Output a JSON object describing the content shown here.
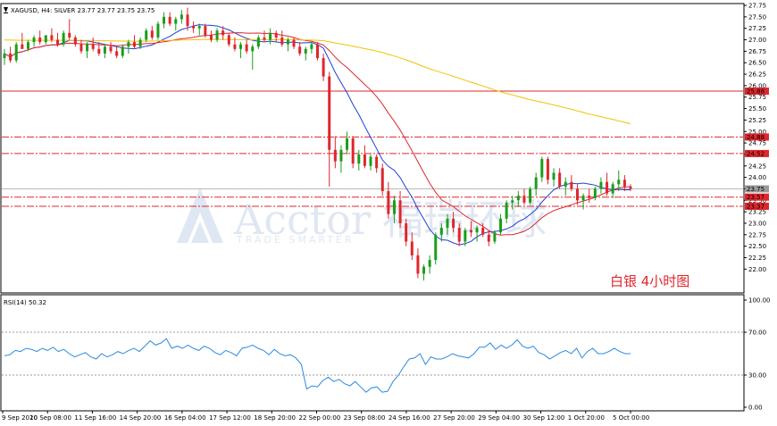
{
  "chart_data": {
    "type": "candlestick",
    "symbol_header": "XAGUSD, H4:  SILVER  23.77 23.77 23.75 23.75",
    "annotation": "白银  4小时图",
    "watermark": {
      "brand": "Acctor",
      "brand_cn": "福瑞环球",
      "tagline": "TRADE SMARTER"
    },
    "main_panel": {
      "y_axis": {
        "min": 21.5,
        "max": 27.75,
        "ticks": [
          "27.75",
          "27.50",
          "27.25",
          "27.00",
          "26.75",
          "26.50",
          "26.25",
          "26.00",
          "25.75",
          "25.50",
          "25.25",
          "25.00",
          "24.75",
          "24.50",
          "24.25",
          "24.00",
          "23.75",
          "23.50",
          "23.25",
          "23.00",
          "22.75",
          "22.50",
          "22.25",
          "22.00"
        ]
      },
      "levels": [
        {
          "label": "25.88",
          "value": 25.88,
          "style": "solid"
        },
        {
          "label": "24.88",
          "value": 24.88,
          "style": "dashdot"
        },
        {
          "label": "24.52",
          "value": 24.52,
          "style": "dashdot"
        },
        {
          "label": "23.57",
          "value": 23.57,
          "style": "dashdot"
        },
        {
          "label": "23.37",
          "value": 23.37,
          "style": "dashdot"
        }
      ],
      "current_price": {
        "label": "23.75",
        "value": 23.75
      },
      "candles": [
        {
          "o": 26.6,
          "h": 26.8,
          "l": 26.45,
          "c": 26.7
        },
        {
          "o": 26.7,
          "h": 26.85,
          "l": 26.5,
          "c": 26.55
        },
        {
          "o": 26.55,
          "h": 26.95,
          "l": 26.5,
          "c": 26.9
        },
        {
          "o": 26.9,
          "h": 27.15,
          "l": 26.8,
          "c": 26.8
        },
        {
          "o": 26.8,
          "h": 27.0,
          "l": 26.75,
          "c": 26.95
        },
        {
          "o": 26.95,
          "h": 27.1,
          "l": 26.85,
          "c": 27.05
        },
        {
          "o": 27.05,
          "h": 27.2,
          "l": 26.9,
          "c": 26.95
        },
        {
          "o": 26.95,
          "h": 27.1,
          "l": 26.9,
          "c": 27.1
        },
        {
          "o": 27.1,
          "h": 27.25,
          "l": 26.95,
          "c": 27.0
        },
        {
          "o": 27.0,
          "h": 27.15,
          "l": 26.85,
          "c": 26.9
        },
        {
          "o": 26.9,
          "h": 27.2,
          "l": 26.85,
          "c": 27.15
        },
        {
          "o": 27.15,
          "h": 27.45,
          "l": 27.0,
          "c": 27.05
        },
        {
          "o": 27.05,
          "h": 27.1,
          "l": 26.85,
          "c": 26.9
        },
        {
          "o": 26.9,
          "h": 27.0,
          "l": 26.7,
          "c": 26.75
        },
        {
          "o": 26.75,
          "h": 26.95,
          "l": 26.6,
          "c": 26.9
        },
        {
          "o": 26.9,
          "h": 27.05,
          "l": 26.75,
          "c": 26.8
        },
        {
          "o": 26.8,
          "h": 26.95,
          "l": 26.65,
          "c": 26.7
        },
        {
          "o": 26.7,
          "h": 26.9,
          "l": 26.6,
          "c": 26.85
        },
        {
          "o": 26.85,
          "h": 26.95,
          "l": 26.7,
          "c": 26.75
        },
        {
          "o": 26.75,
          "h": 26.85,
          "l": 26.6,
          "c": 26.65
        },
        {
          "o": 26.65,
          "h": 26.9,
          "l": 26.6,
          "c": 26.85
        },
        {
          "o": 26.85,
          "h": 27.0,
          "l": 26.7,
          "c": 26.95
        },
        {
          "o": 26.95,
          "h": 27.1,
          "l": 26.8,
          "c": 26.85
        },
        {
          "o": 26.85,
          "h": 27.05,
          "l": 26.8,
          "c": 27.0
        },
        {
          "o": 27.0,
          "h": 27.25,
          "l": 26.95,
          "c": 27.2
        },
        {
          "o": 27.2,
          "h": 27.3,
          "l": 27.0,
          "c": 27.05
        },
        {
          "o": 27.05,
          "h": 27.4,
          "l": 27.0,
          "c": 27.35
        },
        {
          "o": 27.35,
          "h": 27.6,
          "l": 27.25,
          "c": 27.5
        },
        {
          "o": 27.5,
          "h": 27.6,
          "l": 27.3,
          "c": 27.35
        },
        {
          "o": 27.35,
          "h": 27.5,
          "l": 27.2,
          "c": 27.45
        },
        {
          "o": 27.45,
          "h": 27.65,
          "l": 27.35,
          "c": 27.55
        },
        {
          "o": 27.55,
          "h": 27.7,
          "l": 27.2,
          "c": 27.3
        },
        {
          "o": 27.3,
          "h": 27.4,
          "l": 27.15,
          "c": 27.25
        },
        {
          "o": 27.25,
          "h": 27.35,
          "l": 27.1,
          "c": 27.3
        },
        {
          "o": 27.3,
          "h": 27.35,
          "l": 27.05,
          "c": 27.1
        },
        {
          "o": 27.1,
          "h": 27.2,
          "l": 26.95,
          "c": 27.0
        },
        {
          "o": 27.0,
          "h": 27.25,
          "l": 26.95,
          "c": 27.2
        },
        {
          "o": 27.2,
          "h": 27.3,
          "l": 27.0,
          "c": 27.1
        },
        {
          "o": 27.1,
          "h": 27.15,
          "l": 26.85,
          "c": 26.9
        },
        {
          "o": 26.9,
          "h": 27.05,
          "l": 26.75,
          "c": 26.8
        },
        {
          "o": 26.8,
          "h": 26.95,
          "l": 26.6,
          "c": 26.9
        },
        {
          "o": 26.9,
          "h": 27.0,
          "l": 26.7,
          "c": 26.75
        },
        {
          "o": 26.75,
          "h": 26.9,
          "l": 26.35,
          "c": 26.85
        },
        {
          "o": 26.85,
          "h": 27.1,
          "l": 26.8,
          "c": 27.05
        },
        {
          "o": 27.05,
          "h": 27.2,
          "l": 26.95,
          "c": 27.0
        },
        {
          "o": 27.0,
          "h": 27.25,
          "l": 26.9,
          "c": 27.15
        },
        {
          "o": 27.15,
          "h": 27.2,
          "l": 26.95,
          "c": 27.05
        },
        {
          "o": 27.05,
          "h": 27.2,
          "l": 26.85,
          "c": 26.9
        },
        {
          "o": 26.9,
          "h": 27.05,
          "l": 26.75,
          "c": 27.0
        },
        {
          "o": 27.0,
          "h": 27.05,
          "l": 26.8,
          "c": 26.85
        },
        {
          "o": 26.85,
          "h": 26.95,
          "l": 26.65,
          "c": 26.7
        },
        {
          "o": 26.7,
          "h": 26.85,
          "l": 26.55,
          "c": 26.8
        },
        {
          "o": 26.8,
          "h": 26.95,
          "l": 26.7,
          "c": 26.9
        },
        {
          "o": 26.9,
          "h": 26.95,
          "l": 26.55,
          "c": 26.6
        },
        {
          "o": 26.6,
          "h": 26.7,
          "l": 26.1,
          "c": 26.2
        },
        {
          "o": 26.2,
          "h": 26.3,
          "l": 23.8,
          "c": 24.6
        },
        {
          "o": 24.6,
          "h": 24.9,
          "l": 24.2,
          "c": 24.35
        },
        {
          "o": 24.35,
          "h": 24.7,
          "l": 24.1,
          "c": 24.6
        },
        {
          "o": 24.6,
          "h": 25.0,
          "l": 24.5,
          "c": 24.85
        },
        {
          "o": 24.85,
          "h": 24.9,
          "l": 24.2,
          "c": 24.3
        },
        {
          "o": 24.3,
          "h": 24.6,
          "l": 24.15,
          "c": 24.5
        },
        {
          "o": 24.5,
          "h": 24.7,
          "l": 24.2,
          "c": 24.25
        },
        {
          "o": 24.25,
          "h": 24.5,
          "l": 24.15,
          "c": 24.45
        },
        {
          "o": 24.45,
          "h": 24.5,
          "l": 24.1,
          "c": 24.2
        },
        {
          "o": 24.2,
          "h": 24.3,
          "l": 23.6,
          "c": 23.7
        },
        {
          "o": 23.7,
          "h": 23.9,
          "l": 23.1,
          "c": 23.2
        },
        {
          "o": 23.2,
          "h": 23.6,
          "l": 23.0,
          "c": 23.5
        },
        {
          "o": 23.5,
          "h": 23.7,
          "l": 22.9,
          "c": 23.0
        },
        {
          "o": 23.0,
          "h": 23.1,
          "l": 22.5,
          "c": 22.6
        },
        {
          "o": 22.6,
          "h": 22.8,
          "l": 22.2,
          "c": 22.3
        },
        {
          "o": 22.3,
          "h": 22.45,
          "l": 21.8,
          "c": 21.9
        },
        {
          "o": 21.9,
          "h": 22.1,
          "l": 21.75,
          "c": 22.05
        },
        {
          "o": 22.05,
          "h": 22.3,
          "l": 21.9,
          "c": 22.2
        },
        {
          "o": 22.2,
          "h": 22.8,
          "l": 22.1,
          "c": 22.75
        },
        {
          "o": 22.75,
          "h": 23.0,
          "l": 22.6,
          "c": 22.9
        },
        {
          "o": 22.9,
          "h": 23.2,
          "l": 22.75,
          "c": 23.1
        },
        {
          "o": 23.1,
          "h": 23.25,
          "l": 22.8,
          "c": 22.9
        },
        {
          "o": 22.9,
          "h": 23.0,
          "l": 22.5,
          "c": 22.6
        },
        {
          "o": 22.6,
          "h": 22.9,
          "l": 22.5,
          "c": 22.85
        },
        {
          "o": 22.85,
          "h": 23.05,
          "l": 22.7,
          "c": 22.8
        },
        {
          "o": 22.8,
          "h": 22.95,
          "l": 22.6,
          "c": 22.9
        },
        {
          "o": 22.9,
          "h": 23.0,
          "l": 22.7,
          "c": 22.75
        },
        {
          "o": 22.75,
          "h": 22.85,
          "l": 22.5,
          "c": 22.6
        },
        {
          "o": 22.6,
          "h": 22.85,
          "l": 22.55,
          "c": 22.8
        },
        {
          "o": 22.8,
          "h": 23.2,
          "l": 22.75,
          "c": 23.1
        },
        {
          "o": 23.1,
          "h": 23.5,
          "l": 23.0,
          "c": 23.45
        },
        {
          "o": 23.45,
          "h": 23.6,
          "l": 23.3,
          "c": 23.5
        },
        {
          "o": 23.5,
          "h": 23.7,
          "l": 23.35,
          "c": 23.6
        },
        {
          "o": 23.6,
          "h": 23.75,
          "l": 23.4,
          "c": 23.45
        },
        {
          "o": 23.45,
          "h": 23.8,
          "l": 23.4,
          "c": 23.75
        },
        {
          "o": 23.75,
          "h": 24.1,
          "l": 23.6,
          "c": 24.0
        },
        {
          "o": 24.0,
          "h": 24.45,
          "l": 23.9,
          "c": 24.4
        },
        {
          "o": 24.4,
          "h": 24.45,
          "l": 23.85,
          "c": 23.95
        },
        {
          "o": 23.95,
          "h": 24.2,
          "l": 23.8,
          "c": 24.1
        },
        {
          "o": 24.1,
          "h": 24.2,
          "l": 23.75,
          "c": 23.8
        },
        {
          "o": 23.8,
          "h": 24.0,
          "l": 23.6,
          "c": 23.9
        },
        {
          "o": 23.9,
          "h": 24.05,
          "l": 23.7,
          "c": 23.75
        },
        {
          "o": 23.75,
          "h": 23.85,
          "l": 23.4,
          "c": 23.5
        },
        {
          "o": 23.5,
          "h": 23.65,
          "l": 23.3,
          "c": 23.6
        },
        {
          "o": 23.6,
          "h": 23.75,
          "l": 23.45,
          "c": 23.55
        },
        {
          "o": 23.55,
          "h": 23.8,
          "l": 23.5,
          "c": 23.75
        },
        {
          "o": 23.75,
          "h": 24.0,
          "l": 23.65,
          "c": 23.9
        },
        {
          "o": 23.9,
          "h": 24.1,
          "l": 23.6,
          "c": 23.65
        },
        {
          "o": 23.65,
          "h": 23.9,
          "l": 23.55,
          "c": 23.85
        },
        {
          "o": 23.85,
          "h": 24.15,
          "l": 23.7,
          "c": 23.95
        },
        {
          "o": 23.95,
          "h": 24.05,
          "l": 23.7,
          "c": 23.8
        },
        {
          "o": 23.8,
          "h": 23.85,
          "l": 23.7,
          "c": 23.75
        }
      ],
      "moving_averages": [
        {
          "name": "ma-blue",
          "color": "#1f3fd6",
          "period": 10
        },
        {
          "name": "ma-red",
          "color": "#e0262d",
          "period": 20
        },
        {
          "name": "ma-yellow",
          "color": "#f2c200",
          "period": 100
        }
      ]
    },
    "rsi_panel": {
      "label": "RSI(14) 50.32",
      "y_axis": {
        "min": 0,
        "max": 100,
        "ticks": [
          "100.00",
          "70.00",
          "30.00",
          "0.00"
        ]
      },
      "levels": [
        70,
        30
      ],
      "values": [
        48,
        49,
        53,
        52,
        55,
        54,
        52,
        55,
        53,
        56,
        52,
        54,
        50,
        47,
        49,
        51,
        47,
        45,
        50,
        47,
        49,
        52,
        50,
        53,
        55,
        52,
        57,
        62,
        58,
        60,
        64,
        55,
        57,
        55,
        58,
        55,
        53,
        57,
        55,
        51,
        49,
        53,
        51,
        48,
        55,
        56,
        58,
        55,
        53,
        49,
        54,
        50,
        48,
        49,
        46,
        40,
        17,
        20,
        19,
        25,
        28,
        24,
        26,
        22,
        20,
        24,
        19,
        14,
        18,
        19,
        14,
        15,
        24,
        30,
        38,
        45,
        46,
        50,
        40,
        47,
        45,
        45,
        47,
        50,
        48,
        47,
        46,
        50,
        56,
        56,
        60,
        54,
        58,
        55,
        58,
        63,
        57,
        55,
        57,
        51,
        49,
        45,
        48,
        51,
        53,
        50,
        55,
        46,
        52,
        55,
        50,
        50,
        52,
        55,
        52,
        50,
        50
      ]
    },
    "x_axis": {
      "labels": [
        "9 Sep 2020",
        "10 Sep 08:00",
        "11 Sep 16:00",
        "14 Sep 20:00",
        "16 Sep 04:00",
        "17 Sep 12:00",
        "18 Sep 20:00",
        "22 Sep 00:00",
        "23 Sep 08:00",
        "24 Sep 16:00",
        "27 Sep 20:00",
        "29 Sep 04:00",
        "30 Sep 12:00",
        "1 Oct 20:00",
        "5 Oct 00:00"
      ]
    }
  }
}
